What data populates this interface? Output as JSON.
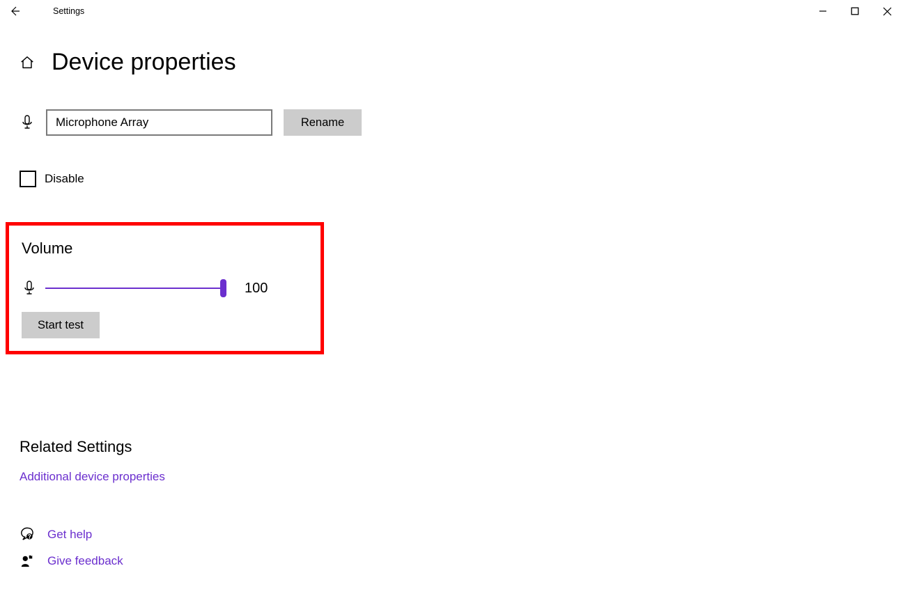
{
  "app_title": "Settings",
  "page_title": "Device properties",
  "device_name": "Microphone Array",
  "rename_label": "Rename",
  "disable_label": "Disable",
  "volume": {
    "heading": "Volume",
    "value": "100",
    "start_test_label": "Start test"
  },
  "related": {
    "heading": "Related Settings",
    "additional_link": "Additional device properties"
  },
  "footer": {
    "get_help": "Get help",
    "give_feedback": "Give feedback"
  }
}
